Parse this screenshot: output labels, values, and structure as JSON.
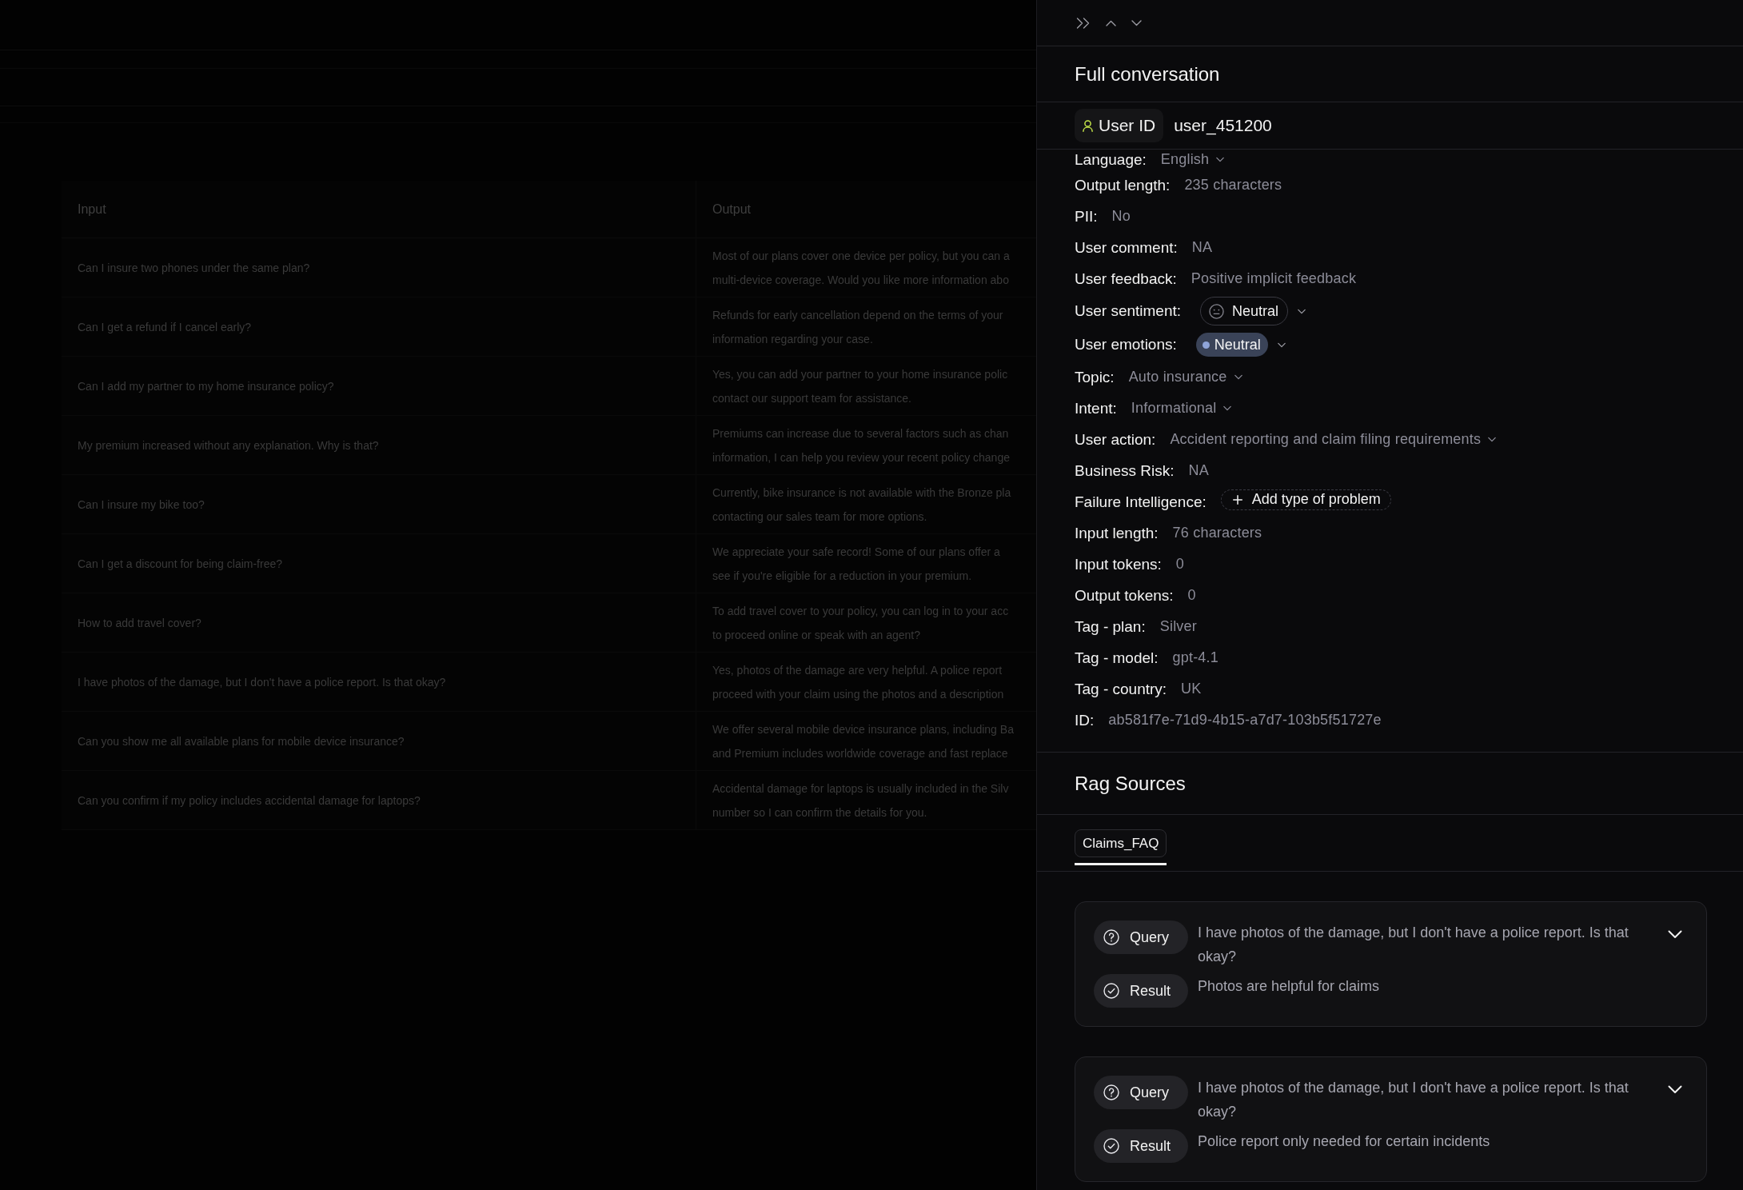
{
  "table": {
    "columns": [
      "Input",
      "Output"
    ],
    "rows": [
      {
        "input": "Can I insure two phones under the same plan?",
        "output": [
          "Most of our plans cover one device per policy, but you can a",
          "multi-device coverage. Would you like more information abo"
        ]
      },
      {
        "input": "Can I get a refund if I cancel early?",
        "output": [
          "Refunds for early cancellation depend on the terms of your",
          "information regarding your case."
        ]
      },
      {
        "input": "Can I add my partner to my home insurance policy?",
        "output": [
          "Yes, you can add your partner to your home insurance polic",
          "contact our support team for assistance."
        ]
      },
      {
        "input": "My premium increased without any explanation. Why is that?",
        "output": [
          "Premiums can increase due to several factors such as chan",
          "information, I can help you review your recent policy change"
        ]
      },
      {
        "input": "Can I insure my bike too?",
        "output": [
          "Currently, bike insurance is not available with the Bronze pla",
          "contacting our sales team for more options."
        ]
      },
      {
        "input": "Can I get a discount for being claim-free?",
        "output": [
          "We appreciate your safe record! Some of our plans offer a",
          "see if you're eligible for a reduction in your premium."
        ]
      },
      {
        "input": "How to add travel cover?",
        "output": [
          "To add travel cover to your policy, you can log in to your acc",
          "to proceed online or speak with an agent?"
        ]
      },
      {
        "input": "I have photos of the damage, but I don't have a police report. Is that okay?",
        "output": [
          "Yes, photos of the damage are very helpful. A police report",
          "proceed with your claim using the photos and a description"
        ]
      },
      {
        "input": "Can you show me all available plans for mobile device insurance?",
        "output": [
          "We offer several mobile device insurance plans, including Ba",
          "and Premium includes worldwide coverage and fast replace"
        ]
      },
      {
        "input": "Can you confirm if my policy includes accidental damage for laptops?",
        "output": [
          "Accidental damage for laptops is usually included in the Silv",
          "number so I can confirm the details for you."
        ]
      }
    ]
  },
  "drawer": {
    "title": "Full conversation",
    "user": {
      "label": "User ID",
      "value": "user_451200"
    },
    "fields": [
      {
        "kind": "select",
        "label": "Language:",
        "value": "English"
      },
      {
        "kind": "text",
        "label": "Output length:",
        "value": "235 characters"
      },
      {
        "kind": "text",
        "label": "PII:",
        "value": "No"
      },
      {
        "kind": "text",
        "label": "User comment:",
        "value": "NA"
      },
      {
        "kind": "text",
        "label": "User feedback:",
        "value": "Positive implicit feedback"
      },
      {
        "kind": "sentiment",
        "label": "User sentiment:",
        "value": "Neutral"
      },
      {
        "kind": "emotion",
        "label": "User emotions:",
        "value": "Neutral"
      },
      {
        "kind": "select",
        "label": "Topic:",
        "value": "Auto insurance"
      },
      {
        "kind": "select",
        "label": "Intent:",
        "value": "Informational"
      },
      {
        "kind": "select",
        "label": "User action:",
        "value": "Accident reporting and claim filing requirements"
      },
      {
        "kind": "text",
        "label": "Business Risk:",
        "value": "NA"
      },
      {
        "kind": "action",
        "label": "Failure Intelligence:",
        "value": "Add type of problem"
      },
      {
        "kind": "text",
        "label": "Input length:",
        "value": "76 characters"
      },
      {
        "kind": "text",
        "label": "Input tokens:",
        "value": "0"
      },
      {
        "kind": "text",
        "label": "Output tokens:",
        "value": "0"
      },
      {
        "kind": "text",
        "label": "Tag - plan:",
        "value": "Silver"
      },
      {
        "kind": "text",
        "label": "Tag - model:",
        "value": "gpt-4.1"
      },
      {
        "kind": "text",
        "label": "Tag - country:",
        "value": "UK"
      },
      {
        "kind": "text",
        "label": "ID:",
        "value": "ab581f7e-71d9-4b15-a7d7-103b5f51727e"
      }
    ]
  },
  "rag": {
    "title": "Rag Sources",
    "tabs": [
      {
        "label": "Claims_FAQ",
        "selected": true
      }
    ],
    "cards": [
      {
        "query_label": "Query",
        "query": "I have photos of the damage, but I don't have a police report. Is that okay?",
        "result_label": "Result",
        "result": "Photos are helpful for claims"
      },
      {
        "query_label": "Query",
        "query": "I have photos of the damage, but I don't have a police report. Is that okay?",
        "result_label": "Result",
        "result": "Police report only needed for certain incidents"
      }
    ]
  }
}
